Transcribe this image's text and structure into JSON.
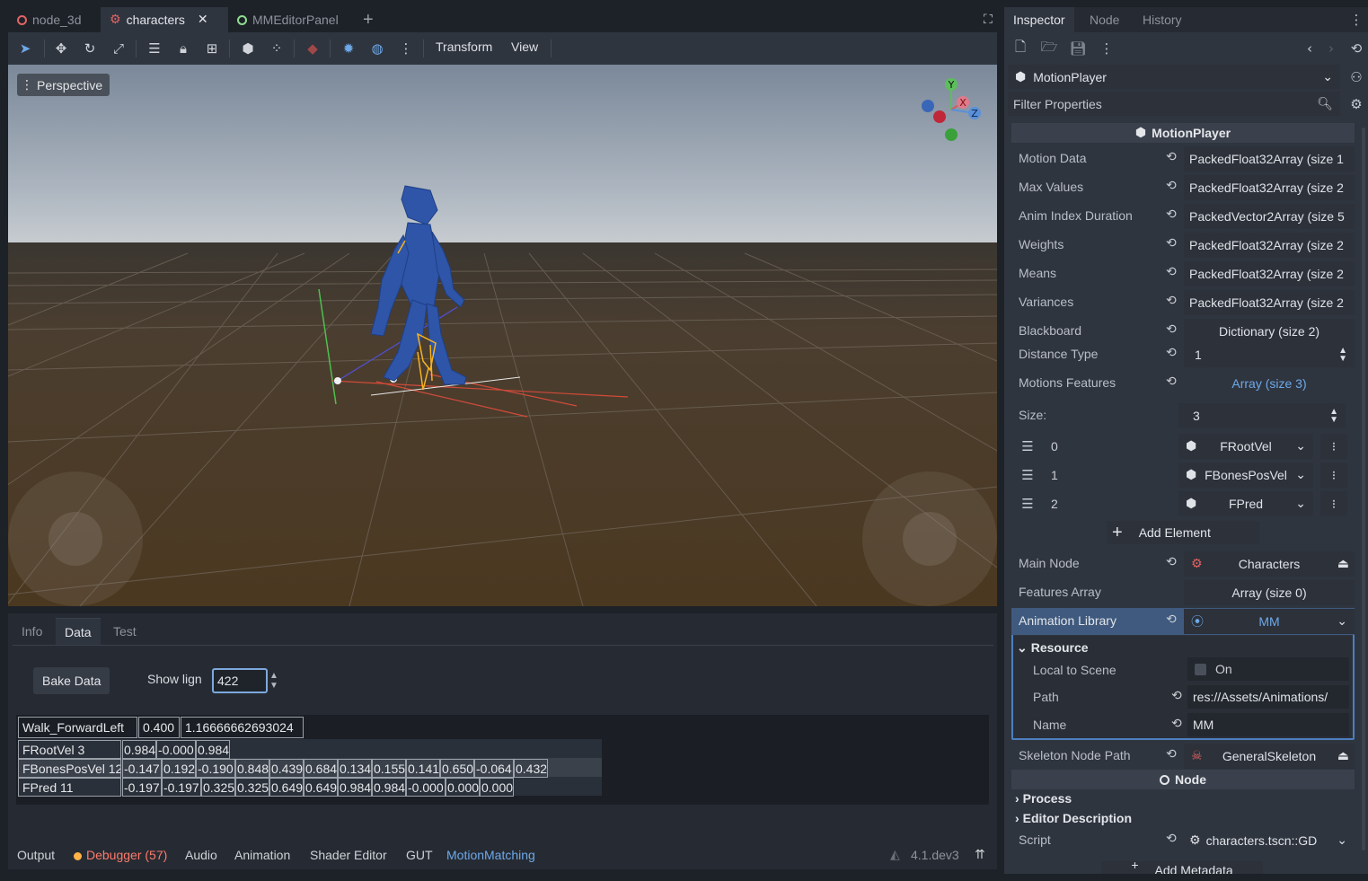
{
  "scene_tabs": [
    {
      "label": "node_3d",
      "icon": "node3d-circle-icon",
      "color": "#e06464"
    },
    {
      "label": "characters",
      "icon": "skeleton-icon",
      "color": "#e06464"
    },
    {
      "label": "MMEditorPanel",
      "icon": "control-circle-icon",
      "color": "#8fdd8f"
    }
  ],
  "toolbar": {
    "transform": "Transform",
    "view": "View"
  },
  "viewport": {
    "mode": "Perspective",
    "gizmo": {
      "x": "X",
      "y": "Y",
      "z": "Z"
    }
  },
  "bottom_panel": {
    "tabs": [
      "Info",
      "Data",
      "Test"
    ],
    "bake_label": "Bake Data",
    "show_label": "Show lign",
    "show_value": "422",
    "header": [
      "Walk_ForwardLeft",
      "0.400",
      "1.16666662693024"
    ],
    "rows": [
      {
        "name": "FRootVel 3",
        "values": [
          "0.984",
          "-0.000",
          "0.984"
        ]
      },
      {
        "name": "FBonesPosVel 12",
        "values": [
          "-0.147",
          "0.192",
          "-0.190",
          "0.848",
          "0.439",
          "0.684",
          "0.134",
          "0.155",
          "0.141",
          "0.650",
          "-0.064",
          "0.432"
        ]
      },
      {
        "name": "FPred 11",
        "values": [
          "-0.197",
          "-0.197",
          "0.325",
          "0.325",
          "0.649",
          "0.649",
          "0.984",
          "0.984",
          "-0.000",
          "0.000",
          "0.000"
        ]
      }
    ]
  },
  "bottom_bar": {
    "items": [
      "Output",
      "Debugger (57)",
      "Audio",
      "Animation",
      "Shader Editor",
      "GUT",
      "MotionMatching"
    ],
    "version": "4.1.dev3"
  },
  "inspector": {
    "tabs": [
      "Inspector",
      "Node",
      "History"
    ],
    "object": "MotionPlayer",
    "filter_placeholder": "Filter Properties",
    "section": "MotionPlayer",
    "props": [
      {
        "label": "Motion Data",
        "value": "PackedFloat32Array (size 1"
      },
      {
        "label": "Max Values",
        "value": "PackedFloat32Array (size 2"
      },
      {
        "label": "Anim Index Duration",
        "value": "PackedVector2Array (size 5"
      },
      {
        "label": "Weights",
        "value": "PackedFloat32Array (size 2"
      },
      {
        "label": "Means",
        "value": "PackedFloat32Array (size 2"
      },
      {
        "label": "Variances",
        "value": "PackedFloat32Array (size 2"
      },
      {
        "label": "Blackboard",
        "value": "Dictionary (size 2)"
      }
    ],
    "distance_type": {
      "label": "Distance Type",
      "value": "1"
    },
    "motions_features": {
      "label": "Motions Features",
      "value": "Array (size 3)"
    },
    "size": {
      "label": "Size:",
      "value": "3"
    },
    "elements": [
      {
        "index": "0",
        "value": "FRootVel"
      },
      {
        "index": "1",
        "value": "FBonesPosVel"
      },
      {
        "index": "2",
        "value": "FPred"
      }
    ],
    "add_element": "Add Element",
    "main_node": {
      "label": "Main Node",
      "value": "Characters"
    },
    "features_array": {
      "label": "Features Array",
      "value": "Array (size 0)"
    },
    "animation_library": {
      "label": "Animation Library",
      "value": "MM"
    },
    "resource": {
      "title": "Resource",
      "local_label": "Local to Scene",
      "local_value": "On",
      "path_label": "Path",
      "path_value": "res://Assets/Animations/",
      "name_label": "Name",
      "name_value": "MM"
    },
    "skeleton": {
      "label": "Skeleton Node Path",
      "value": "GeneralSkeleton"
    },
    "node_section": "Node",
    "process": "Process",
    "editor_description": "Editor Description",
    "script": {
      "label": "Script",
      "value": "characters.tscn::GD"
    },
    "add_metadata": "Add Metadata"
  },
  "colors": {
    "accent": "#6ea8e8",
    "debugger": "#ff7a6a",
    "bg": "#262b33"
  }
}
